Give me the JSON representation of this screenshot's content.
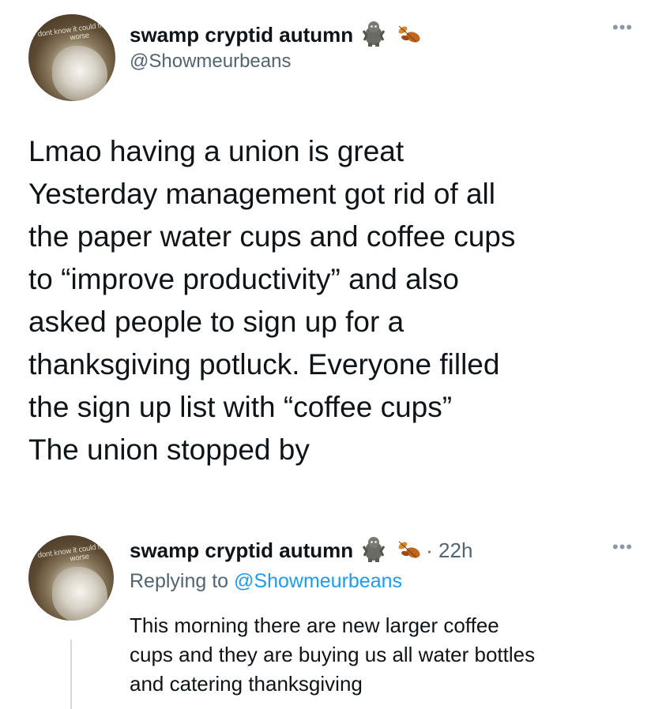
{
  "main_tweet": {
    "display_name": "swamp cryptid autumn",
    "handle": "@Showmeurbeans",
    "avatar_scribble": "dont know it could fit... lot worse",
    "emoji_icons": [
      "yeti-icon",
      "autumn-leaves-icon"
    ],
    "more_icon": "more-options-icon",
    "text_lines": [
      "Lmao having a union is great",
      "Yesterday management got rid of all",
      "the paper water cups and coffee cups",
      "to “improve productivity” and also",
      "asked people to sign up for a",
      "thanksgiving potluck. Everyone filled",
      "the sign up list with “coffee cups”",
      "The union stopped by"
    ]
  },
  "reply_tweet": {
    "display_name": "swamp cryptid autumn",
    "time": "· 22h",
    "replying_prefix": "Replying to",
    "replying_handle": "@Showmeurbeans",
    "text_lines": [
      "This morning there are new larger coffee",
      "cups and they are buying us all water bottles",
      "and catering thanksgiving"
    ]
  },
  "colors": {
    "text": "#0f1419",
    "secondary": "#536471",
    "link": "#1d9bf0",
    "thread_line": "#cfd9de"
  }
}
